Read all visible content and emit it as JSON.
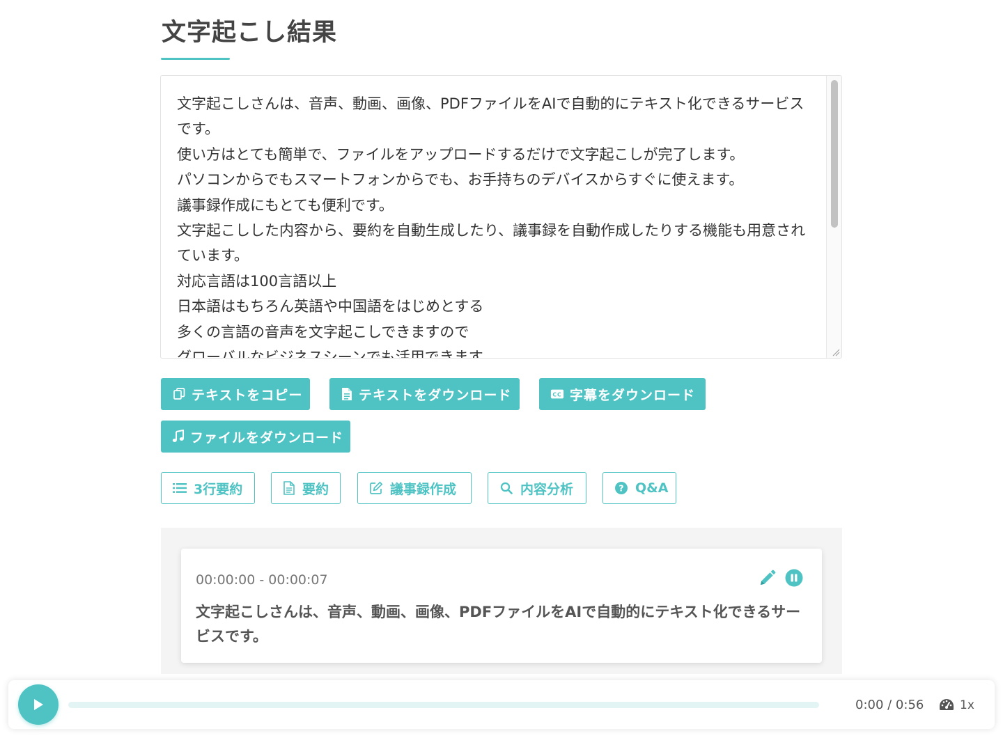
{
  "page": {
    "title": "文字起こし結果"
  },
  "transcript": {
    "text": "文字起こしさんは、音声、動画、画像、PDFファイルをAIで自動的にテキスト化できるサービスです。\n使い方はとても簡単で、ファイルをアップロードするだけで文字起こしが完了します。\nパソコンからでもスマートフォンからでも、お手持ちのデバイスからすぐに使えます。\n議事録作成にもとても便利です。\n文字起こしした内容から、要約を自動生成したり、議事録を自動作成したりする機能も用意されています。\n対応言語は100言語以上\n日本語はもちろん英語や中国語をはじめとする\n多くの言語の音声を文字起こしできますので\nグローバルなビジネスシーンでも活用できます"
  },
  "actions": {
    "copy_text": "テキストをコピー",
    "download_text": "テキストをダウンロード",
    "download_subtitles": "字幕をダウンロード",
    "download_file": "ファイルをダウンロード"
  },
  "ai_tools": {
    "summary_3": "3行要約",
    "summary": "要約",
    "minutes": "議事録作成",
    "analysis": "内容分析",
    "qa": "Q&A"
  },
  "segment": {
    "time_range": "00:00:00 - 00:00:07",
    "text": "文字起こしさんは、音声、動画、画像、PDFファイルをAIで自動的にテキスト化できるサービスです。"
  },
  "player": {
    "time": "0:00 / 0:56",
    "speed": "1x",
    "progress": 0
  },
  "colors": {
    "accent": "#4fc3c3"
  }
}
